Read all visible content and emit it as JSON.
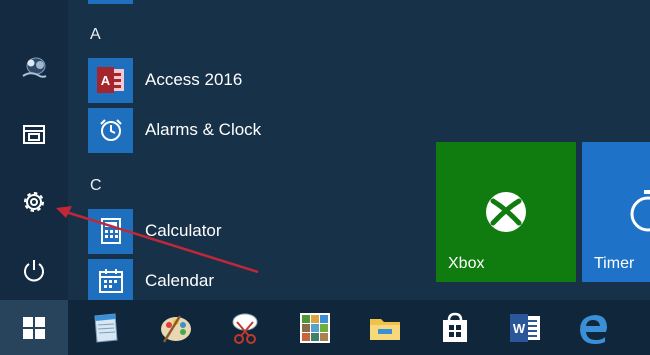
{
  "start_menu": {
    "sections": [
      {
        "letter": "A",
        "apps": [
          {
            "label": "Access 2016",
            "icon": "access-icon"
          },
          {
            "label": "Alarms & Clock",
            "icon": "alarm-clock-icon"
          }
        ]
      },
      {
        "letter": "C",
        "apps": [
          {
            "label": "Calculator",
            "icon": "calculator-icon"
          },
          {
            "label": "Calendar",
            "icon": "calendar-icon"
          }
        ]
      }
    ],
    "rail": [
      {
        "name": "user-avatar",
        "icon": "user-avatar-icon"
      },
      {
        "name": "file-explorer",
        "icon": "file-explorer-icon"
      },
      {
        "name": "settings",
        "icon": "gear-icon"
      },
      {
        "name": "power",
        "icon": "power-icon"
      }
    ],
    "tiles": [
      {
        "label": "Xbox",
        "color": "#107c10",
        "icon": "xbox-icon"
      },
      {
        "label": "Timer",
        "color": "#1e73c8",
        "icon": "timer-icon"
      }
    ]
  },
  "taskbar": {
    "start_icon": "windows-logo-icon",
    "apps": [
      {
        "name": "notepad",
        "icon": "notepad-icon"
      },
      {
        "name": "paint",
        "icon": "paint-palette-icon"
      },
      {
        "name": "snipping-tool",
        "icon": "snipping-tool-icon"
      },
      {
        "name": "photos",
        "icon": "photos-icon"
      },
      {
        "name": "file-explorer",
        "icon": "folder-icon"
      },
      {
        "name": "store",
        "icon": "store-bag-icon"
      },
      {
        "name": "word",
        "icon": "word-icon"
      },
      {
        "name": "edge",
        "icon": "edge-icon"
      }
    ]
  },
  "colors": {
    "accent": "#1f6fbf",
    "xbox_green": "#107c10",
    "annotation_arrow": "#c0283a"
  }
}
